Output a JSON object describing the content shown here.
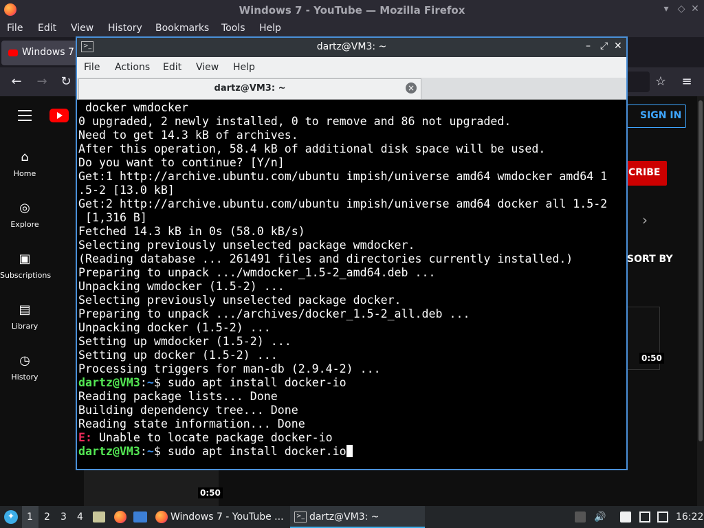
{
  "firefox": {
    "window_title": "Windows 7 - YouTube — Mozilla Firefox",
    "menu": [
      "File",
      "Edit",
      "View",
      "History",
      "Bookmarks",
      "Tools",
      "Help"
    ],
    "tab_label": "Windows 7"
  },
  "youtube": {
    "nav": [
      {
        "label": "Home",
        "icon": "home-icon"
      },
      {
        "label": "Explore",
        "icon": "compass-icon"
      },
      {
        "label": "Subscriptions",
        "icon": "subscriptions-icon"
      },
      {
        "label": "Library",
        "icon": "library-icon"
      },
      {
        "label": "History",
        "icon": "history-icon"
      }
    ],
    "sign_in": "SIGN IN",
    "subscribe_partial": "CRIBE",
    "sort_by": "SORT BY",
    "durations": [
      "0:50",
      "0:50"
    ]
  },
  "terminal": {
    "window_title": "dartz@VM3: ~",
    "menu": [
      "File",
      "Actions",
      "Edit",
      "View",
      "Help"
    ],
    "tab_label": "dartz@VM3: ~",
    "prompt_user": "dartz@VM3",
    "prompt_path": "~",
    "lines": [
      " docker wmdocker",
      "0 upgraded, 2 newly installed, 0 to remove and 86 not upgraded.",
      "Need to get 14.3 kB of archives.",
      "After this operation, 58.4 kB of additional disk space will be used.",
      "Do you want to continue? [Y/n]",
      "Get:1 http://archive.ubuntu.com/ubuntu impish/universe amd64 wmdocker amd64 1",
      ".5-2 [13.0 kB]",
      "Get:2 http://archive.ubuntu.com/ubuntu impish/universe amd64 docker all 1.5-2",
      " [1,316 B]",
      "Fetched 14.3 kB in 0s (58.0 kB/s)",
      "Selecting previously unselected package wmdocker.",
      "(Reading database ... 261491 files and directories currently installed.)",
      "Preparing to unpack .../wmdocker_1.5-2_amd64.deb ...",
      "Unpacking wmdocker (1.5-2) ...",
      "Selecting previously unselected package docker.",
      "Preparing to unpack .../archives/docker_1.5-2_all.deb ...",
      "Unpacking docker (1.5-2) ...",
      "Setting up wmdocker (1.5-2) ...",
      "Setting up docker (1.5-2) ...",
      "Processing triggers for man-db (2.9.4-2) ..."
    ],
    "cmd1": "sudo apt install docker-io",
    "after_cmd1": [
      "Reading package lists... Done",
      "Building dependency tree... Done",
      "Reading state information... Done"
    ],
    "error_tag": "E:",
    "error_msg": " Unable to locate package docker-io",
    "cmd2": "sudo apt install docker.io"
  },
  "taskbar": {
    "desktops": [
      "1",
      "2",
      "3",
      "4"
    ],
    "tasks": [
      "Windows 7 - YouTube ...",
      "dartz@VM3: ~"
    ],
    "clock": "16:22"
  },
  "colors": {
    "terminal_green": "#54e854",
    "terminal_blue": "#3b8eea",
    "terminal_red": "#ed2b5a",
    "youtube_red": "#ff0000",
    "link_blue": "#3ea6ff"
  }
}
